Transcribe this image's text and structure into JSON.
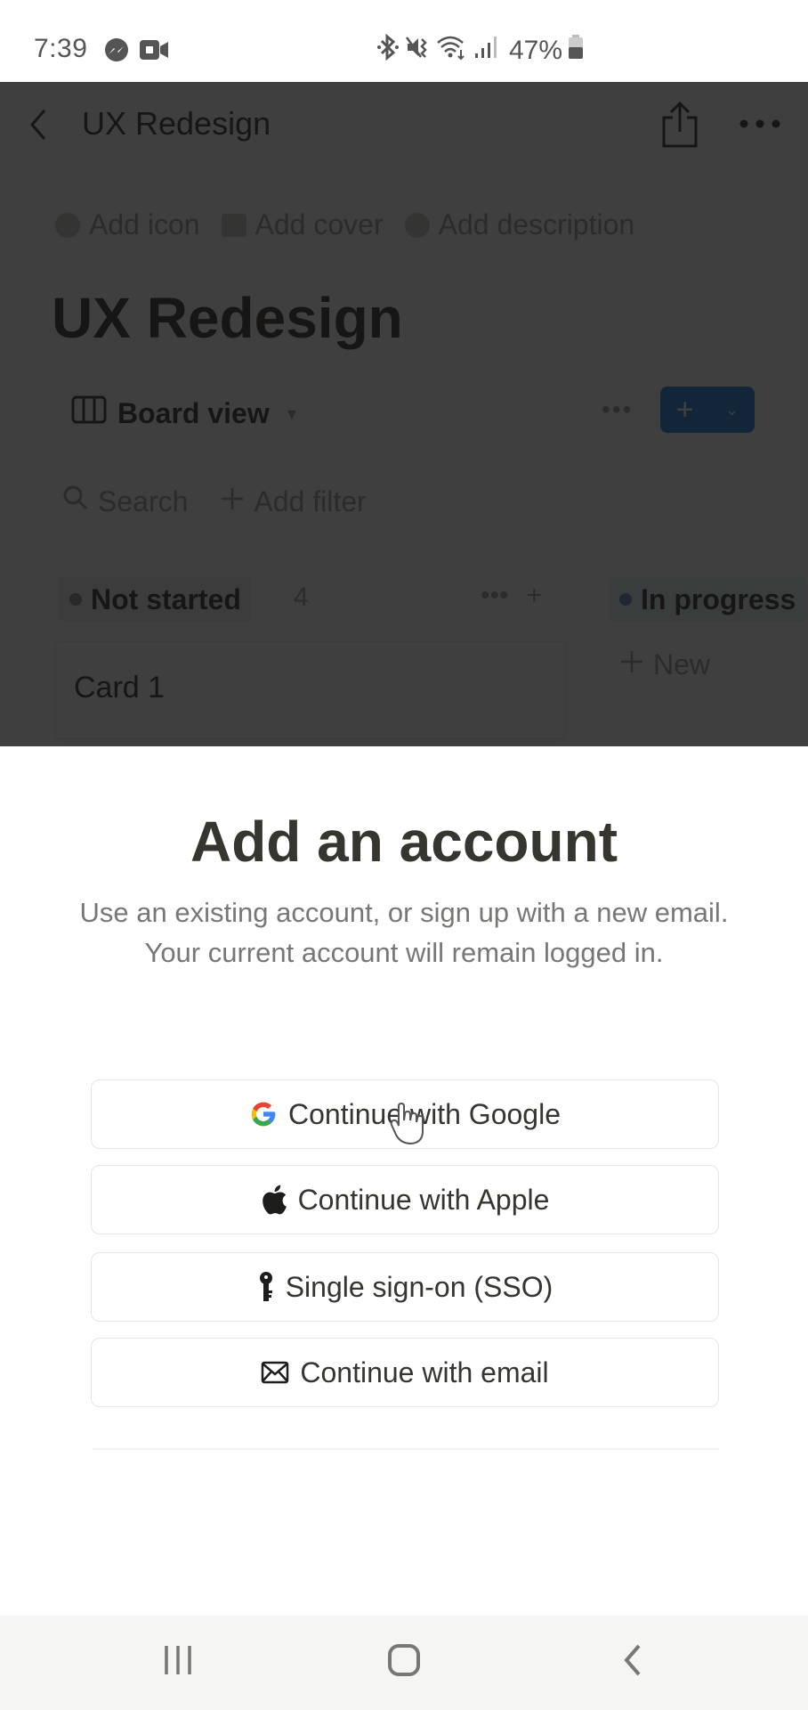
{
  "status_bar": {
    "time": "7:39",
    "left_icons": [
      "messenger-icon",
      "video-call-icon"
    ],
    "right_icons": [
      "bluetooth-icon",
      "vibrate-icon",
      "wifi-icon",
      "signal-icon"
    ],
    "battery_percent": "47%"
  },
  "background_page": {
    "topbar_title": "UX Redesign",
    "meta_actions": [
      {
        "label": "Add icon",
        "icon": "emoji-icon"
      },
      {
        "label": "Add cover",
        "icon": "image-icon"
      },
      {
        "label": "Add description",
        "icon": "info-icon"
      }
    ],
    "page_title": "UX Redesign",
    "view_label": "Board view",
    "view_more": "•••",
    "new_button_plus": "+",
    "new_button_caret": "⌄",
    "search_label": "Search",
    "add_filter_label": "Add filter",
    "groups": [
      {
        "name": "Not started",
        "count": "4",
        "color": "#91918e"
      },
      {
        "name": "In progress",
        "color": "#5e87c9"
      }
    ],
    "group_actions_more": "•••",
    "group_actions_add": "+",
    "cards": [
      {
        "title": "Card 1"
      }
    ],
    "new_card_label": "New"
  },
  "sheet": {
    "title": "Add an account",
    "subtitle": "Use an existing account, or sign up with a new email. Your current account will remain logged in.",
    "buttons": [
      {
        "label": "Continue with Google",
        "icon": "google-icon"
      },
      {
        "label": "Continue with Apple",
        "icon": "apple-icon"
      },
      {
        "label": "Single sign-on (SSO)",
        "icon": "key-icon"
      },
      {
        "label": "Continue with email",
        "icon": "mail-icon"
      }
    ]
  },
  "nav_bar": {
    "buttons": [
      "recents",
      "home",
      "back"
    ]
  },
  "colors": {
    "accent_blue": "#2383e2",
    "text_primary": "#37352f",
    "text_secondary": "#787774",
    "google_blue": "#4285F4",
    "google_red": "#EA4335",
    "google_yellow": "#FBBC05",
    "google_green": "#34A853"
  }
}
